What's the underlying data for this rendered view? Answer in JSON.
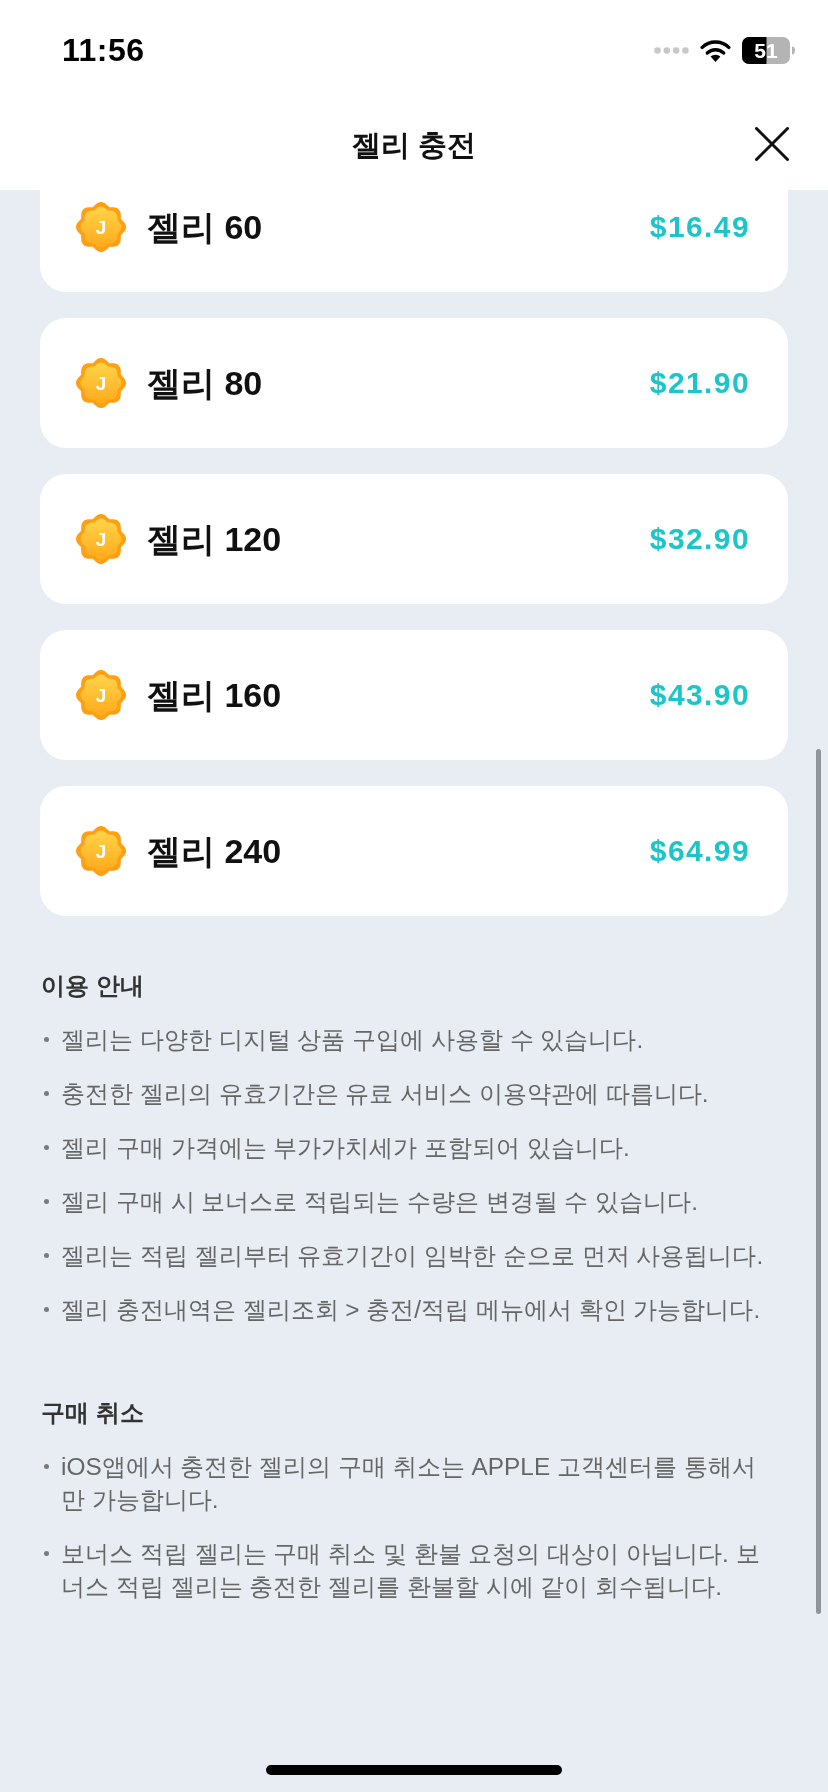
{
  "status_bar": {
    "time": "11:56",
    "battery": "51"
  },
  "header": {
    "title": "젤리 충전"
  },
  "products": [
    {
      "coin_label": "J",
      "name": "젤리 60",
      "price": "$16.49"
    },
    {
      "coin_label": "J",
      "name": "젤리 80",
      "price": "$21.90"
    },
    {
      "coin_label": "J",
      "name": "젤리 120",
      "price": "$32.90"
    },
    {
      "coin_label": "J",
      "name": "젤리 160",
      "price": "$43.90"
    },
    {
      "coin_label": "J",
      "name": "젤리 240",
      "price": "$64.99"
    }
  ],
  "sections": [
    {
      "heading": "이용 안내",
      "items": [
        "젤리는 다양한 디지털 상품 구입에 사용할 수 있습니다.",
        "충전한 젤리의 유효기간은 유료 서비스 이용약관에 따릅니다.",
        "젤리 구매 가격에는 부가가치세가 포함되어 있습니다.",
        "젤리 구매 시 보너스로 적립되는 수량은 변경될 수 있습니다.",
        "젤리는 적립 젤리부터 유효기간이 임박한 순으로 먼저 사용됩니다.",
        "젤리 충전내역은 젤리조회 > 충전/적립 메뉴에서 확인 가능합니다."
      ]
    },
    {
      "heading": "구매 취소",
      "items": [
        "iOS앱에서 충전한 젤리의 구매 취소는 APPLE 고객센터를 통해서만 가능합니다.",
        "보너스 적립 젤리는 구매 취소 및 환불 요청의 대상이 아닙니다. 보너스 적립 젤리는 충전한 젤리를 환불할 시에 같이 회수됩니다."
      ]
    }
  ]
}
